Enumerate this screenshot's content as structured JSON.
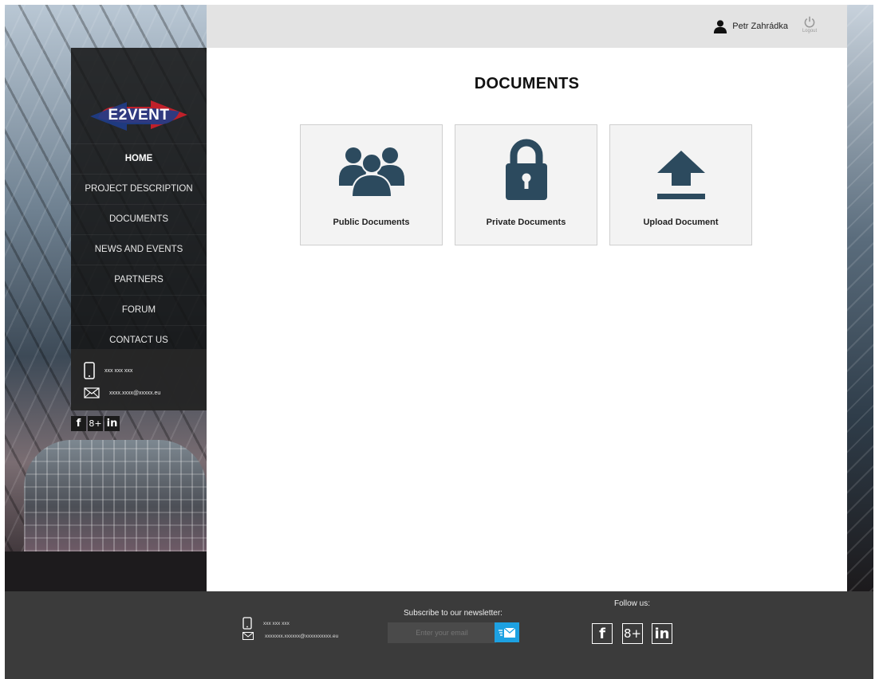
{
  "header": {
    "user_name": "Petr Zahrádka",
    "logout_label": "Logout"
  },
  "main": {
    "title": "DOCUMENTS",
    "cards": [
      {
        "label": "Public Documents",
        "icon": "users-group-icon"
      },
      {
        "label": "Private Documents",
        "icon": "lock-icon"
      },
      {
        "label": "Upload Document",
        "icon": "upload-icon"
      }
    ]
  },
  "sidebar": {
    "logo_text": "E2VENT",
    "nav": [
      {
        "label": "HOME",
        "active": true
      },
      {
        "label": "PROJECT DESCRIPTION"
      },
      {
        "label": "DOCUMENTS"
      },
      {
        "label": "NEWS AND EVENTS"
      },
      {
        "label": "PARTNERS"
      },
      {
        "label": "FORUM"
      },
      {
        "label": "CONTACT US"
      }
    ],
    "phone": "xxx xxx xxx",
    "email": "xxxx.xxxx@xxxxx.eu",
    "social": [
      "f",
      "8+",
      "in"
    ]
  },
  "footer": {
    "phone": "xxx xxx xxx",
    "email": "xxxxxxx.xxxxxx@xxxxxxxxxx.eu",
    "newsletter_label": "Subscribe to our newsletter:",
    "email_placeholder": "Enter your email",
    "follow_label": "Follow us:",
    "social": [
      "f",
      "8+",
      "in"
    ]
  },
  "colors": {
    "icon": "#2c4a5e",
    "accent": "#1da1e2",
    "sidebar": "#141414",
    "footer": "#3b3b3b"
  }
}
